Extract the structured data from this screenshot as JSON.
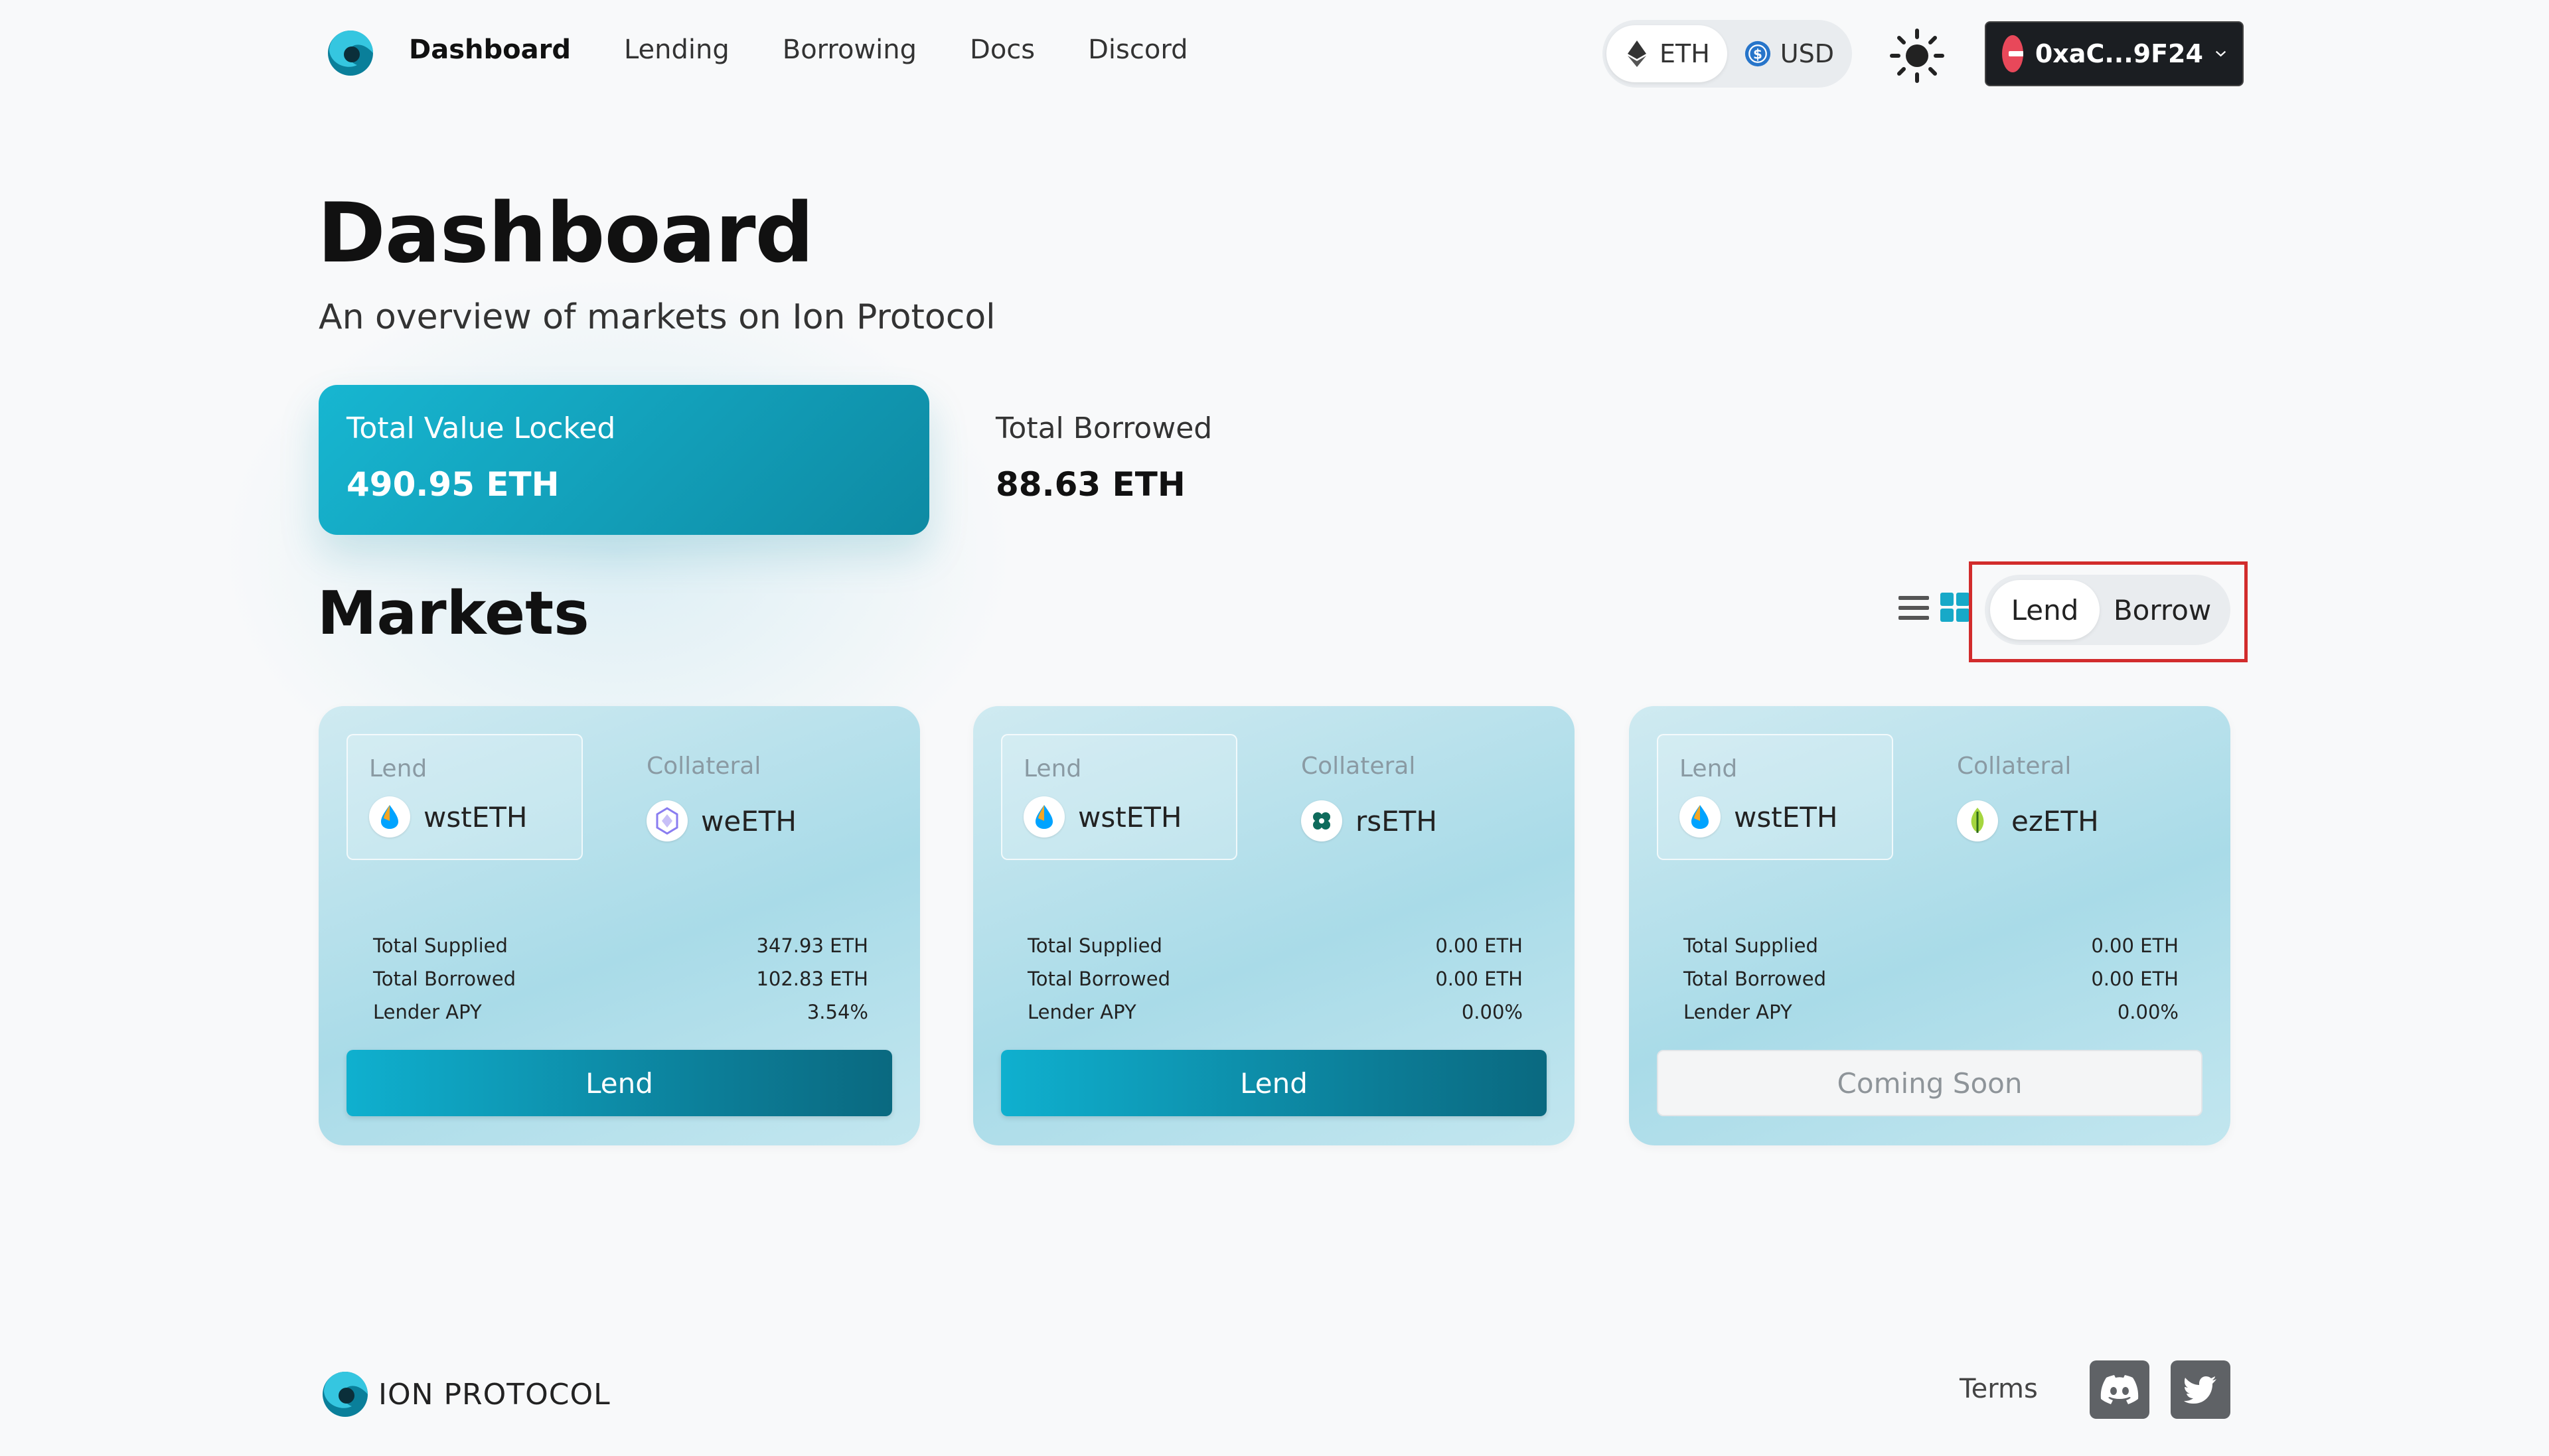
{
  "nav": {
    "items": [
      {
        "label": "Dashboard",
        "active": true
      },
      {
        "label": "Lending",
        "active": false
      },
      {
        "label": "Borrowing",
        "active": false
      },
      {
        "label": "Docs",
        "active": false
      },
      {
        "label": "Discord",
        "active": false
      }
    ]
  },
  "currency": {
    "eth_label": "ETH",
    "usd_label": "USD",
    "selected": "ETH"
  },
  "wallet": {
    "address": "0xaC...9F24"
  },
  "page": {
    "title": "Dashboard",
    "subtitle": "An overview of markets on Ion Protocol"
  },
  "stats": {
    "tvl_label": "Total Value Locked",
    "tvl_value": "490.95 ETH",
    "borrowed_label": "Total Borrowed",
    "borrowed_value": "88.63 ETH"
  },
  "markets": {
    "title": "Markets",
    "toggle": {
      "lend_label": "Lend",
      "borrow_label": "Borrow",
      "selected": "Lend"
    },
    "view_mode": "grid",
    "cards": [
      {
        "lend_label": "Lend",
        "lend_asset": "wstETH",
        "collateral_label": "Collateral",
        "collateral_asset": "weETH",
        "rows": [
          {
            "label": "Total Supplied",
            "value": "347.93 ETH"
          },
          {
            "label": "Total Borrowed",
            "value": "102.83 ETH"
          },
          {
            "label": "Lender APY",
            "value": "3.54%"
          }
        ],
        "button_label": "Lend",
        "enabled": true
      },
      {
        "lend_label": "Lend",
        "lend_asset": "wstETH",
        "collateral_label": "Collateral",
        "collateral_asset": "rsETH",
        "rows": [
          {
            "label": "Total Supplied",
            "value": "0.00 ETH"
          },
          {
            "label": "Total Borrowed",
            "value": "0.00 ETH"
          },
          {
            "label": "Lender APY",
            "value": "0.00%"
          }
        ],
        "button_label": "Lend",
        "enabled": true
      },
      {
        "lend_label": "Lend",
        "lend_asset": "wstETH",
        "collateral_label": "Collateral",
        "collateral_asset": "ezETH",
        "rows": [
          {
            "label": "Total Supplied",
            "value": "0.00 ETH"
          },
          {
            "label": "Total Borrowed",
            "value": "0.00 ETH"
          },
          {
            "label": "Lender APY",
            "value": "0.00%"
          }
        ],
        "button_label": "Coming Soon",
        "enabled": false
      }
    ]
  },
  "footer": {
    "brand": "ION PROTOCOL",
    "terms": "Terms"
  },
  "colors": {
    "accent": "#17b6d1",
    "accent_dark": "#0c7c96",
    "wallet_bg": "#1b1e22",
    "highlight": "#d22c2c"
  }
}
